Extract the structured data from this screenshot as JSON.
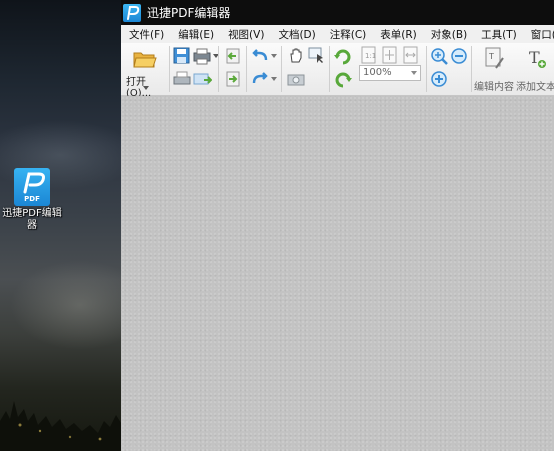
{
  "desktop": {
    "icon_label": "迅捷PDF编辑器",
    "icon_badge": "PDF"
  },
  "window": {
    "title": "迅捷PDF编辑器",
    "menu": [
      "文件(F)",
      "编辑(E)",
      "视图(V)",
      "文档(D)",
      "注释(C)",
      "表单(R)",
      "对象(B)",
      "工具(T)",
      "窗口(W)"
    ],
    "toolbar": {
      "open_label": "打开(O)...",
      "zoom_value": "100%",
      "edit_content_label": "编辑内容",
      "add_text_label": "添加文本"
    }
  },
  "colors": {
    "titlebar": "#0d0d0d",
    "accent": "#2a9de0",
    "doc_bg": "#c3c3c3"
  }
}
